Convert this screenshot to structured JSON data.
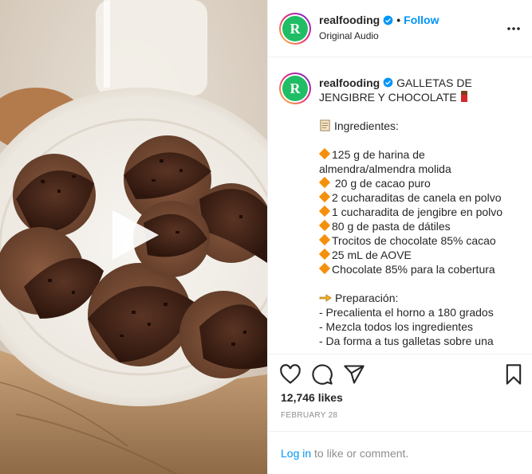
{
  "post": {
    "username": "realfooding",
    "follow_label": "Follow",
    "dot": "•",
    "audio": "Original Audio",
    "avatar_letter": "R",
    "caption": {
      "title": "GALLETAS DE JENGIBRE Y CHOCOLATE",
      "ingredients_heading": "Ingredientes:",
      "ingredients": [
        "125 g de harina de almendra/almendra molida",
        " 20 g de cacao puro",
        "2 cucharaditas de canela en polvo",
        "1 cucharadita de jengibre en polvo",
        "80 g de pasta de dátiles",
        "Trocitos de chocolate 85% cacao",
        "25 mL de AOVE",
        "Chocolate 85% para la cobertura"
      ],
      "preparation_heading": "Preparación:",
      "steps": [
        "- Precalienta el horno a 180 grados",
        "- Mezcla todos los ingredientes",
        "- Da forma a tus galletas sobre una"
      ]
    },
    "likes": "12,746 likes",
    "date": "FEBRUARY 28",
    "login_link": "Log in",
    "login_rest": " to like or comment."
  },
  "icons": {
    "verified": "verified-badge-icon",
    "more": "more-options-icon",
    "like": "heart-icon",
    "comment": "comment-icon",
    "share": "share-icon",
    "save": "bookmark-icon",
    "play": "play-icon"
  },
  "colors": {
    "accent": "#0095f6",
    "brand": "#1fbd64",
    "muted": "#8e8e8e",
    "border": "#efefef"
  }
}
